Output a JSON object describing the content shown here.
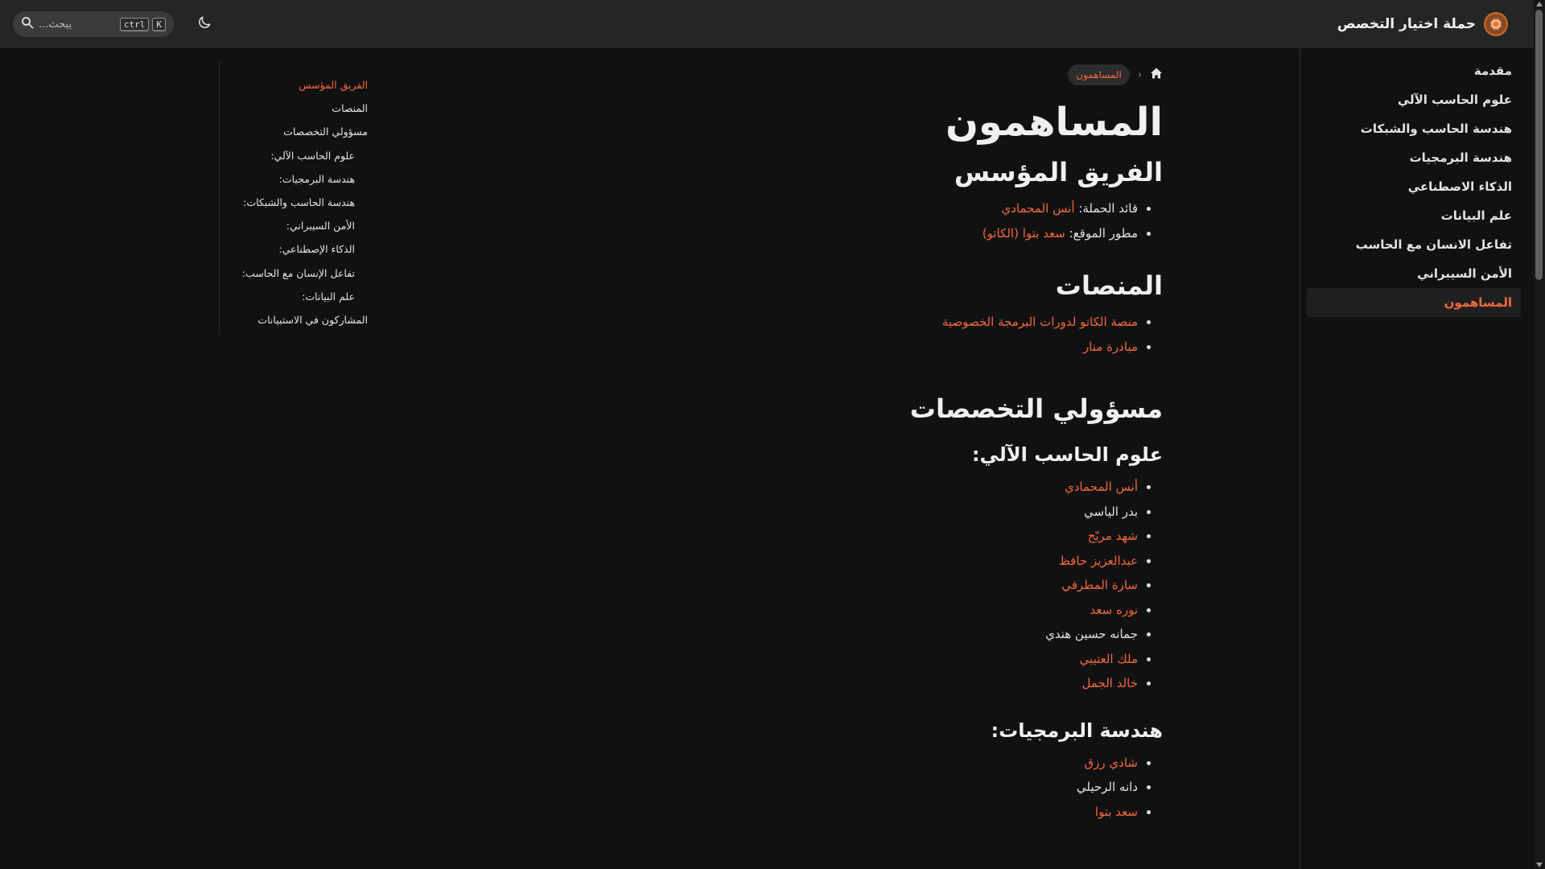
{
  "navbar": {
    "title": "حملة اختيار التخصص",
    "logo_icon": "circuit-logo-icon",
    "search_placeholder": "يبحث...",
    "kbd_ctrl": "ctrl",
    "kbd_k": "K",
    "theme_icon": "moon-icon"
  },
  "sidebar": {
    "items": [
      {
        "label": "مقدمة"
      },
      {
        "label": "علوم الحاسب الآلي"
      },
      {
        "label": "هندسة الحاسب والشبكات"
      },
      {
        "label": "هندسة البرمجيات"
      },
      {
        "label": "الذكاء الاصطناعي"
      },
      {
        "label": "علم البيانات"
      },
      {
        "label": "تفاعل الانسان مع الحاسب"
      },
      {
        "label": "الأمن السيبراني"
      },
      {
        "label": "المساهمون"
      }
    ]
  },
  "breadcrumb": {
    "home_icon": "home-icon",
    "current": "المساهمون"
  },
  "main": {
    "title": "المساهمون",
    "founders": {
      "heading": "الفريق المؤسس",
      "items": [
        {
          "label": "قائد الحملة:",
          "link": "أنس المحمادي"
        },
        {
          "label": "مطور الموقع:",
          "link": "سعد بتوا (الكاتو)"
        }
      ]
    },
    "platforms": {
      "heading": "المنصات",
      "items": [
        {
          "link": "منصة الكاتو لدورات البرمجة الخصوصية"
        },
        {
          "link": "مبادرة منار"
        }
      ]
    },
    "leads": {
      "heading": "مسؤولي التخصصات",
      "cs": {
        "heading": "علوم الحاسب الآلي:",
        "items": [
          {
            "name": "أنس المحمادي",
            "linked": true
          },
          {
            "name": "بدر الياسي",
            "linked": false
          },
          {
            "name": "شهد مريّح",
            "linked": true
          },
          {
            "name": "عبدالعزيز حافظ",
            "linked": true
          },
          {
            "name": "سارة المطرفي",
            "linked": true
          },
          {
            "name": "نوره سعد",
            "linked": true
          },
          {
            "name": "جمانه حسين هندي",
            "linked": false
          },
          {
            "name": "ملك العتيبي",
            "linked": true
          },
          {
            "name": "خالد الجمل",
            "linked": true
          }
        ]
      },
      "se": {
        "heading": "هندسة البرمجيات:",
        "items": [
          {
            "name": "شادي رزق",
            "linked": true
          },
          {
            "name": "دانه الرحيلي",
            "linked": false
          },
          {
            "name": "سعد بتوا",
            "linked": true
          }
        ]
      }
    }
  },
  "toc": {
    "items": [
      {
        "label": "الفريق المؤسس",
        "sub": false
      },
      {
        "label": "المنصات",
        "sub": false
      },
      {
        "label": "مسؤولي التخصصات",
        "sub": false
      },
      {
        "label": "علوم الحاسب الآلي:",
        "sub": true
      },
      {
        "label": "هندسة البرمجيات:",
        "sub": true
      },
      {
        "label": "هندسة الحاسب والشبكات:",
        "sub": true
      },
      {
        "label": "الأمن السيبراني:",
        "sub": true
      },
      {
        "label": "الذكاء الإصطناعي:",
        "sub": true
      },
      {
        "label": "تفاعل الإنسان مع الحاسب:",
        "sub": true
      },
      {
        "label": "علم البيانات:",
        "sub": true
      },
      {
        "label": "المشاركون في الاستبيانات",
        "sub": false
      }
    ]
  },
  "colors": {
    "accent": "#f2683c",
    "background": "#111111",
    "navbar": "#242526",
    "text": "#e3e3e3"
  }
}
